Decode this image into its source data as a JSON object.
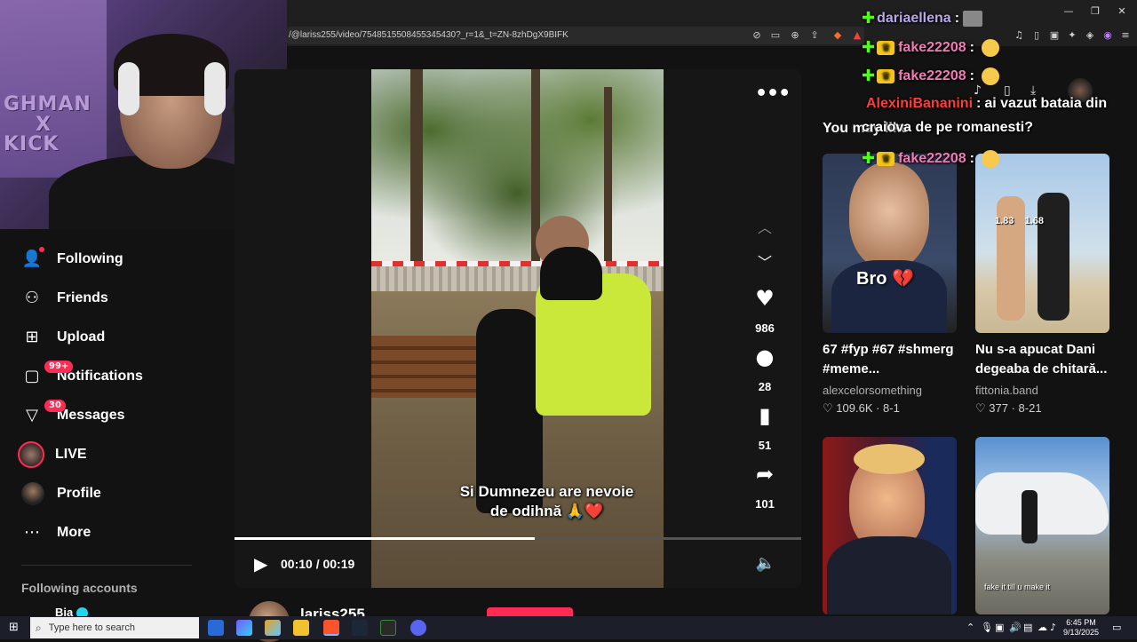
{
  "browser": {
    "url": "/@lariss255/video/7548515508455345430?_r=1&_t=ZN-8zhDgX9BIFK"
  },
  "sidebar": {
    "items": [
      {
        "label": "Following",
        "icon": "following-icon"
      },
      {
        "label": "Friends",
        "icon": "friends-icon"
      },
      {
        "label": "Upload",
        "icon": "upload-icon"
      },
      {
        "label": "Notifications",
        "icon": "notifications-icon",
        "badge": "99+"
      },
      {
        "label": "Messages",
        "icon": "messages-icon",
        "badge": "30"
      },
      {
        "label": "LIVE",
        "icon": "live-icon"
      },
      {
        "label": "Profile",
        "icon": "profile-icon"
      },
      {
        "label": "More",
        "icon": "more-icon"
      }
    ],
    "following_accounts_title": "Following accounts",
    "following_accounts": [
      {
        "name": "Bia"
      }
    ]
  },
  "webcam": {
    "overlay_text_1": "GHMAN",
    "overlay_text_2": "X",
    "overlay_text_3": "KICK"
  },
  "video": {
    "subtitle_line1": "Si Dumnezeu are nevoie",
    "subtitle_line2": "de odihnă 🙏❤️",
    "progress": 0.53,
    "current_time": "00:10",
    "duration": "00:19",
    "time_display": "00:10 / 00:19",
    "author": "lariss255"
  },
  "actions": {
    "likes": "986",
    "comments": "28",
    "bookmarks": "51",
    "shares": "101"
  },
  "recommendations": {
    "title": "You may like",
    "cards": [
      {
        "thumb_text": "Bro 💔",
        "title": "67 #fyp #67 #shmerg #meme...",
        "author": "alexcelorsomething",
        "likes": "109.6K",
        "date": "8-1"
      },
      {
        "thumb_text": "1.83    1.68",
        "title": "Nu s-a apucat Dani degeaba de chitară...",
        "author": "fittonia.band",
        "likes": "377",
        "date": "8-21"
      },
      {
        "thumb_text": "",
        "title": "",
        "author": "",
        "likes": "",
        "date": ""
      },
      {
        "thumb_text": "fake it till u make it",
        "title": "",
        "author": "",
        "likes": "",
        "date": ""
      }
    ]
  },
  "chat": [
    {
      "user": "dariaellena",
      "message": "",
      "user_color": "#b9a9e8",
      "badge": "kick"
    },
    {
      "user": "fake22208",
      "message": "",
      "user_color": "#f07bb5",
      "badge": "kick-crown"
    },
    {
      "user": "fake22208",
      "message": "",
      "user_color": "#f07bb5",
      "badge": "kick-crown"
    },
    {
      "user": "AlexiniBananini",
      "message": "ai vazut bataia din craiova de pe romanesti?",
      "user_color": "#ff3b3b",
      "badge": ""
    },
    {
      "user": "fake22208",
      "message": "",
      "user_color": "#f07bb5",
      "badge": "kick-crown"
    }
  ],
  "chat_separator": ":",
  "chat_msg_line1": "ai vazut bataia din",
  "chat_msg_line2": "craiova de pe romanesti?",
  "taskbar": {
    "search_placeholder": "Type here to search",
    "time": "6:45 PM",
    "date": "9/13/2025"
  },
  "colors": {
    "accent": "#fe2c55",
    "kick_green": "#53fc18",
    "background": "#121212"
  }
}
